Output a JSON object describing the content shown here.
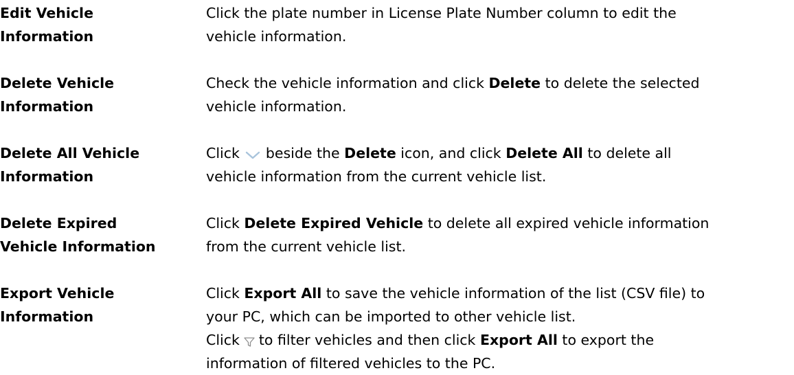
{
  "rows": [
    {
      "term": [
        "Edit Vehicle",
        "Information"
      ],
      "desc": {
        "l1": "Click the plate number in License Plate Number column to edit the",
        "l2": "vehicle information."
      }
    },
    {
      "term": [
        "Delete Vehicle",
        "Information"
      ],
      "desc": {
        "l1a": "Check the vehicle information and click ",
        "l1b": "Delete",
        "l1c": " to delete the selected",
        "l2": "vehicle information."
      }
    },
    {
      "term": [
        "Delete All Vehicle",
        "Information"
      ],
      "desc": {
        "l1a": "Click",
        "l1b": "beside the ",
        "l1c": "Delete",
        "l1d": " icon, and click ",
        "l1e": "Delete All",
        "l1f": " to delete all",
        "l2": "vehicle information from the current vehicle list."
      }
    },
    {
      "term": [
        "Delete Expired",
        "Vehicle Information"
      ],
      "desc": {
        "l1a": "Click ",
        "l1b": "Delete Expired Vehicle",
        "l1c": " to delete all expired vehicle information",
        "l2": "from the current vehicle list."
      }
    },
    {
      "term": [
        "Export Vehicle",
        "Information"
      ],
      "desc": {
        "l1a": "Click ",
        "l1b": "Export All",
        "l1c": " to save the vehicle information of the list (CSV file) to",
        "l2": "your PC, which can be imported to other vehicle list.",
        "l3a": "Click",
        "l3b": "to filter vehicles and then click ",
        "l3c": "Export All",
        "l3d": " to export the",
        "l4": "information of filtered vehicles to the PC."
      }
    }
  ],
  "icons": {
    "chevron": "chevron-down-icon",
    "filter": "filter-icon"
  }
}
